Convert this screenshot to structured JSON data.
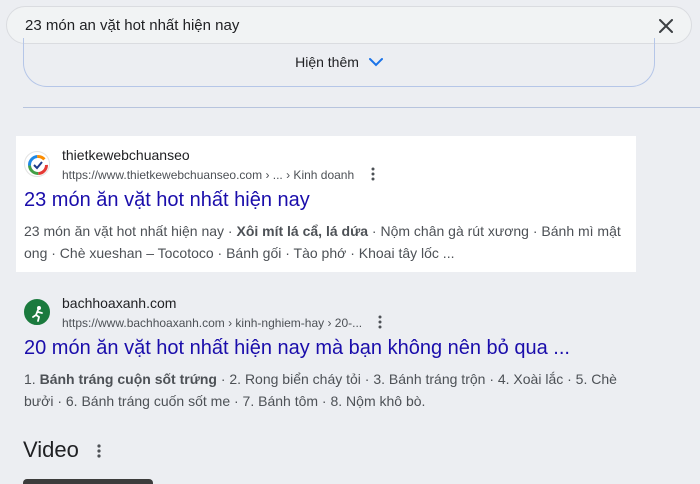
{
  "search": {
    "query": "23 món an vặt hot nhất hiện nay"
  },
  "show_more": {
    "label": "Hiện thêm"
  },
  "results": [
    {
      "site_name": "thietkewebchuanseo",
      "url": "https://www.thietkewebchuanseo.com › ... › Kinh doanh",
      "title": "23 món ăn vặt hot nhất hiện nay",
      "snippet": [
        {
          "text": "23 món ăn vặt hot nhất hiện nay · ",
          "bold": false
        },
        {
          "text": "Xôi mít lá cẩ, lá dứa",
          "bold": true
        },
        {
          "text": " · Nộm chân gà rút xương · Bánh mì mật ong · Chè xueshan – Tocotoco · Bánh gối · Tào phớ · Khoai tây lốc ...",
          "bold": false
        }
      ]
    },
    {
      "site_name": "bachhoaxanh.com",
      "url": "https://www.bachhoaxanh.com › kinh-nghiem-hay › 20-...",
      "title": "20 món ăn vặt hot nhất hiện nay mà bạn không nên bỏ qua ...",
      "snippet": [
        {
          "text": "1. ",
          "bold": false
        },
        {
          "text": "Bánh tráng cuộn sốt trứng",
          "bold": true
        },
        {
          "text": " · 2. Rong biển cháy tỏi · 3. Bánh tráng trộn · 4. Xoài lắc · 5. Chè bưởi · 6. Bánh tráng cuốn sốt me · 7. Bánh tôm · 8. Nộm khô bò.",
          "bold": false
        }
      ]
    }
  ],
  "video_section": {
    "heading": "Video"
  },
  "colors": {
    "link": "#1a0dab",
    "highlight_bg": "#ffffff",
    "page_bg": "#eceef2"
  }
}
